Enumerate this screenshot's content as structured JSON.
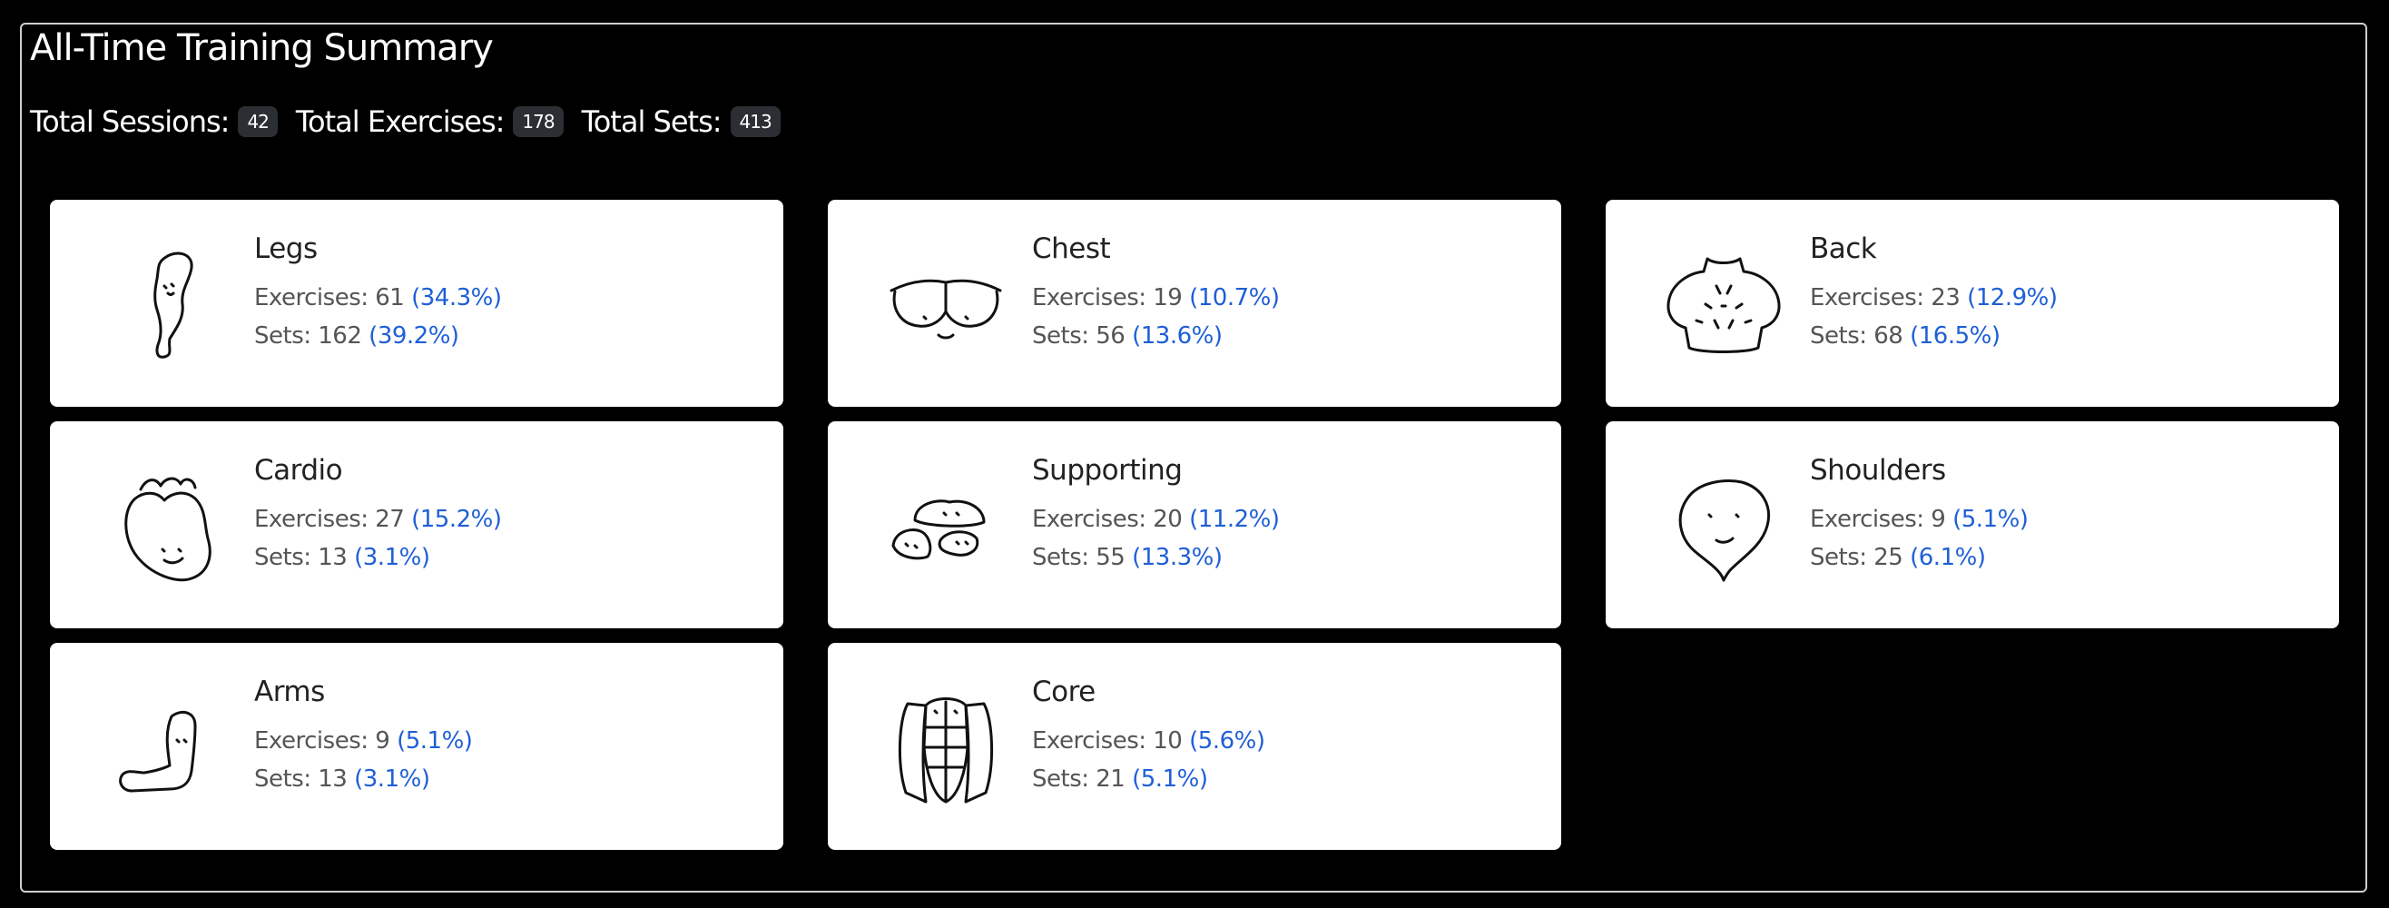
{
  "summary": {
    "title": "All-Time Training Summary",
    "sessions_label": "Total Sessions:",
    "sessions_value": "42",
    "exercises_label": "Total Exercises:",
    "exercises_value": "178",
    "sets_label": "Total Sets:",
    "sets_value": "413"
  },
  "stat_labels": {
    "exercises": "Exercises:",
    "sets": "Sets:"
  },
  "colors": {
    "background": "#000000",
    "card": "#ffffff",
    "percent": "#1f5fd6",
    "badge": "#2b2f34"
  },
  "groups": [
    {
      "name": "Legs",
      "icon": "leg-icon",
      "exercises": "61",
      "exercises_pct": "(34.3%)",
      "sets": "162",
      "sets_pct": "(39.2%)"
    },
    {
      "name": "Chest",
      "icon": "chest-icon",
      "exercises": "19",
      "exercises_pct": "(10.7%)",
      "sets": "56",
      "sets_pct": "(13.6%)"
    },
    {
      "name": "Back",
      "icon": "back-icon",
      "exercises": "23",
      "exercises_pct": "(12.9%)",
      "sets": "68",
      "sets_pct": "(16.5%)"
    },
    {
      "name": "Cardio",
      "icon": "heart-icon",
      "exercises": "27",
      "exercises_pct": "(15.2%)",
      "sets": "13",
      "sets_pct": "(3.1%)"
    },
    {
      "name": "Supporting",
      "icon": "supporting-icon",
      "exercises": "20",
      "exercises_pct": "(11.2%)",
      "sets": "55",
      "sets_pct": "(13.3%)"
    },
    {
      "name": "Shoulders",
      "icon": "shoulder-icon",
      "exercises": "9",
      "exercises_pct": "(5.1%)",
      "sets": "25",
      "sets_pct": "(6.1%)"
    },
    {
      "name": "Arms",
      "icon": "arm-icon",
      "exercises": "9",
      "exercises_pct": "(5.1%)",
      "sets": "13",
      "sets_pct": "(3.1%)"
    },
    {
      "name": "Core",
      "icon": "core-icon",
      "exercises": "10",
      "exercises_pct": "(5.6%)",
      "sets": "21",
      "sets_pct": "(5.1%)"
    }
  ]
}
